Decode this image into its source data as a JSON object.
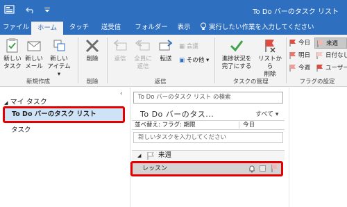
{
  "window": {
    "title": "To Do バーのタスク リスト"
  },
  "ribbon_tabs": [
    {
      "label": "ファイル",
      "active": false
    },
    {
      "label": "ホーム",
      "active": true
    },
    {
      "label": "タッチ",
      "active": false
    },
    {
      "label": "送受信",
      "active": false
    },
    {
      "label": "フォルダー",
      "active": false
    },
    {
      "label": "表示",
      "active": false
    }
  ],
  "tell_me": "実行したい作業を入力してください",
  "ribbon": {
    "new_group": {
      "new_task": "新しい\nタスク",
      "new_mail": "新しい\nメール",
      "new_items": "新しい\nアイテム",
      "label": "新規作成"
    },
    "delete_group": {
      "delete": "削除",
      "label": "削除"
    },
    "respond_group": {
      "reply": "返信",
      "reply_all": "全員に\n返信",
      "forward": "転送",
      "meeting": "会議",
      "more": "その他",
      "label": "返信"
    },
    "manage_group": {
      "mark_complete": "進捗状況を\n完了にする",
      "remove_from_list": "リストから\n削除",
      "label": "タスクの管理"
    },
    "flags_group": {
      "today": "今日",
      "tomorrow": "明日",
      "this_week": "今週",
      "next_week": "来週",
      "no_date": "日付なし",
      "custom": "ユーザー",
      "label": "フラグの設定"
    }
  },
  "nav": {
    "header": "マイ タスク",
    "items": [
      {
        "label": "To Do バーのタスク リスト",
        "selected": true
      },
      {
        "label": "タスク",
        "selected": false
      }
    ]
  },
  "tasklist": {
    "search_placeholder": "To Do バーのタスク リスト の検索",
    "title": "To Do バーのタス...",
    "filter": "すべて",
    "sort_label": "並べ替え: フラグ: 期限",
    "sort_value": "今日",
    "new_task_placeholder": "新しいタスクを入力してください",
    "groups": [
      {
        "name": "来週",
        "tasks": [
          {
            "subject": "レッスン"
          }
        ]
      }
    ]
  },
  "colors": {
    "accent": "#2e6fbf",
    "highlight": "#e50000",
    "flag": "#e04a3f",
    "check": "#3fa24c"
  }
}
